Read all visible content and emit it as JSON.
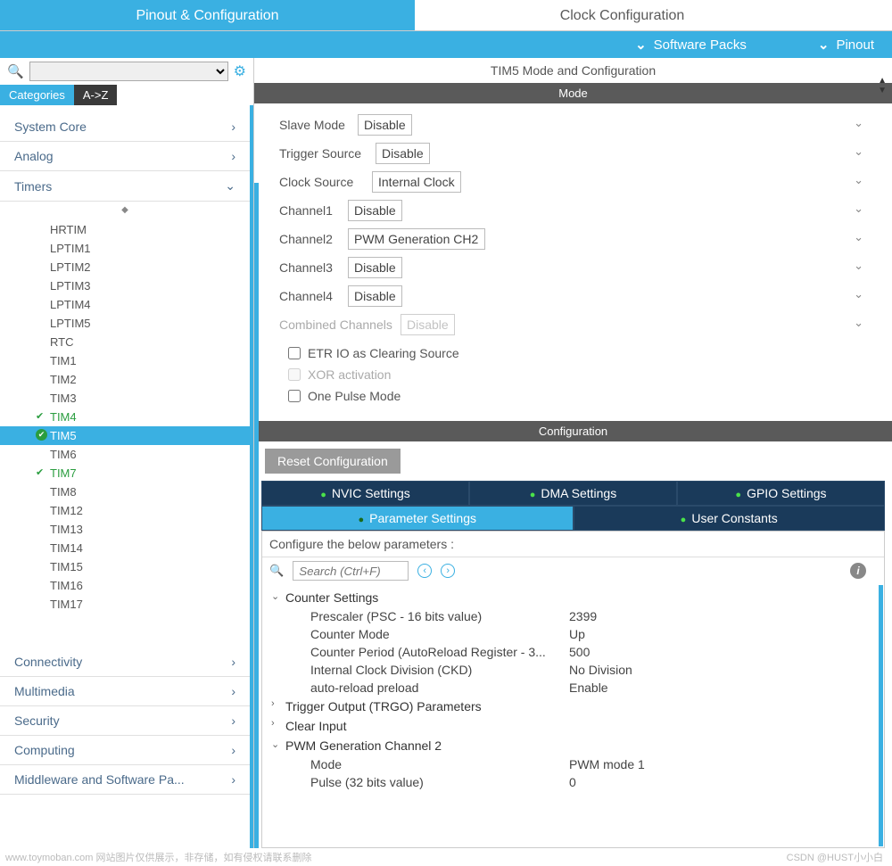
{
  "topTabs": {
    "pinout": "Pinout & Configuration",
    "clock": "Clock Configuration"
  },
  "subBar": {
    "packs": "Software Packs",
    "pinout": "Pinout"
  },
  "catTabs": {
    "categories": "Categories",
    "az": "A->Z"
  },
  "sections": {
    "systemCore": "System Core",
    "analog": "Analog",
    "timers": "Timers",
    "connectivity": "Connectivity",
    "multimedia": "Multimedia",
    "security": "Security",
    "computing": "Computing",
    "middleware": "Middleware and Software Pa..."
  },
  "timers": [
    "HRTIM",
    "LPTIM1",
    "LPTIM2",
    "LPTIM3",
    "LPTIM4",
    "LPTIM5",
    "RTC",
    "TIM1",
    "TIM2",
    "TIM3",
    "TIM4",
    "TIM5",
    "TIM6",
    "TIM7",
    "TIM8",
    "TIM12",
    "TIM13",
    "TIM14",
    "TIM15",
    "TIM16",
    "TIM17"
  ],
  "timersChecked": [
    "TIM4",
    "TIM7"
  ],
  "timersSelected": "TIM5",
  "panelTitle": "TIM5 Mode and Configuration",
  "modeHeader": "Mode",
  "mode": {
    "slave": {
      "label": "Slave Mode",
      "value": "Disable"
    },
    "trigger": {
      "label": "Trigger Source",
      "value": "Disable"
    },
    "clock": {
      "label": "Clock Source",
      "value": "Internal Clock"
    },
    "ch1": {
      "label": "Channel1",
      "value": "Disable"
    },
    "ch2": {
      "label": "Channel2",
      "value": "PWM Generation CH2"
    },
    "ch3": {
      "label": "Channel3",
      "value": "Disable"
    },
    "ch4": {
      "label": "Channel4",
      "value": "Disable"
    },
    "combined": {
      "label": "Combined Channels",
      "value": "Disable"
    },
    "etr": "ETR IO as Clearing Source",
    "xor": "XOR activation",
    "onePulse": "One Pulse Mode"
  },
  "configHeader": "Configuration",
  "resetBtn": "Reset Configuration",
  "cfgTabs": {
    "nvic": "NVIC Settings",
    "dma": "DMA Settings",
    "gpio": "GPIO Settings",
    "param": "Parameter Settings",
    "user": "User Constants"
  },
  "cfgHint": "Configure the below parameters :",
  "searchPlaceholder": "Search (Ctrl+F)",
  "params": {
    "counterSettings": "Counter Settings",
    "prescaler": {
      "k": "Prescaler (PSC - 16 bits value)",
      "v": "2399"
    },
    "counterMode": {
      "k": "Counter Mode",
      "v": "Up"
    },
    "period": {
      "k": "Counter Period (AutoReload Register - 3...",
      "v": "500"
    },
    "ckd": {
      "k": "Internal Clock Division (CKD)",
      "v": "No Division"
    },
    "autoReload": {
      "k": "auto-reload preload",
      "v": "Enable"
    },
    "trgo": "Trigger Output (TRGO) Parameters",
    "clearInput": "Clear Input",
    "pwmCh2": "PWM Generation Channel 2",
    "pwmMode": {
      "k": "Mode",
      "v": "PWM mode 1"
    },
    "pulse": {
      "k": "Pulse (32 bits value)",
      "v": "0"
    }
  },
  "watermark": "www.toymoban.com 网站图片仅供展示，非存储，如有侵权请联系删除",
  "credit": "CSDN @HUST小小白"
}
